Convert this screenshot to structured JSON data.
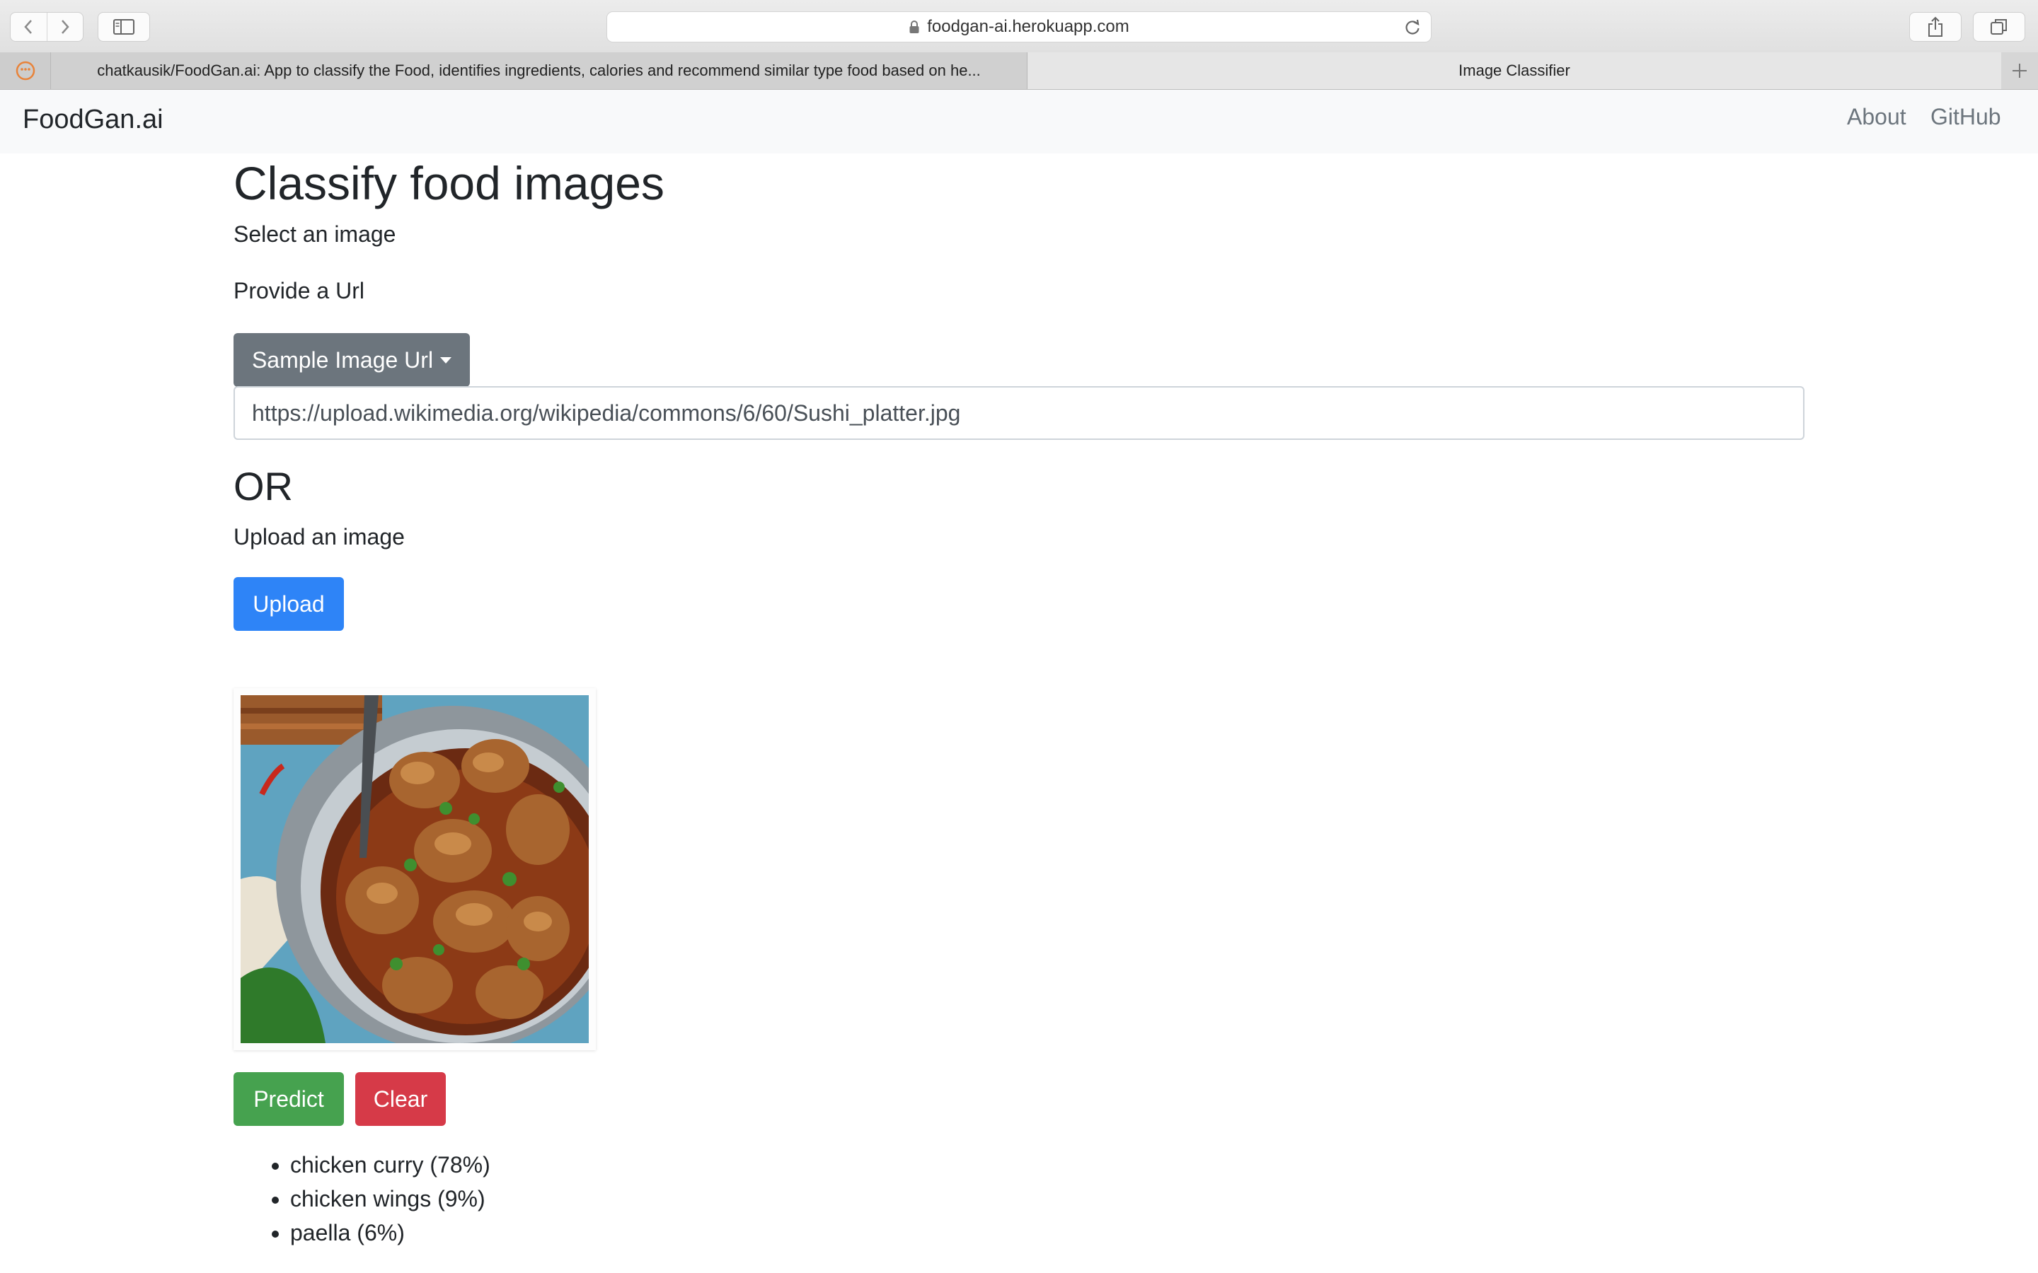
{
  "browser": {
    "address": "foodgan-ai.herokuapp.com",
    "tabs": [
      {
        "label": "chatkausik/FoodGan.ai: App to classify the Food, identifies ingredients, calories and recommend similar type food based on he...",
        "active": false
      },
      {
        "label": "Image Classifier",
        "active": true
      }
    ]
  },
  "navbar": {
    "brand": "FoodGan.ai",
    "links": [
      "About",
      "GitHub"
    ]
  },
  "main": {
    "title": "Classify food images",
    "select_label": "Select an image",
    "url_label": "Provide a Url",
    "sample_button": "Sample Image Url",
    "url_value": "https://upload.wikimedia.org/wikipedia/commons/6/60/Sushi_platter.jpg",
    "or_heading": "OR",
    "upload_label": "Upload an image",
    "upload_button": "Upload",
    "predict_button": "Predict",
    "clear_button": "Clear",
    "predictions": [
      "chicken curry (78%)",
      "chicken wings (9%)",
      "paella (6%)"
    ]
  },
  "colors": {
    "secondary": "#6c757d",
    "primary": "#2e84f7",
    "success": "#46a24f",
    "danger": "#d63a48"
  }
}
